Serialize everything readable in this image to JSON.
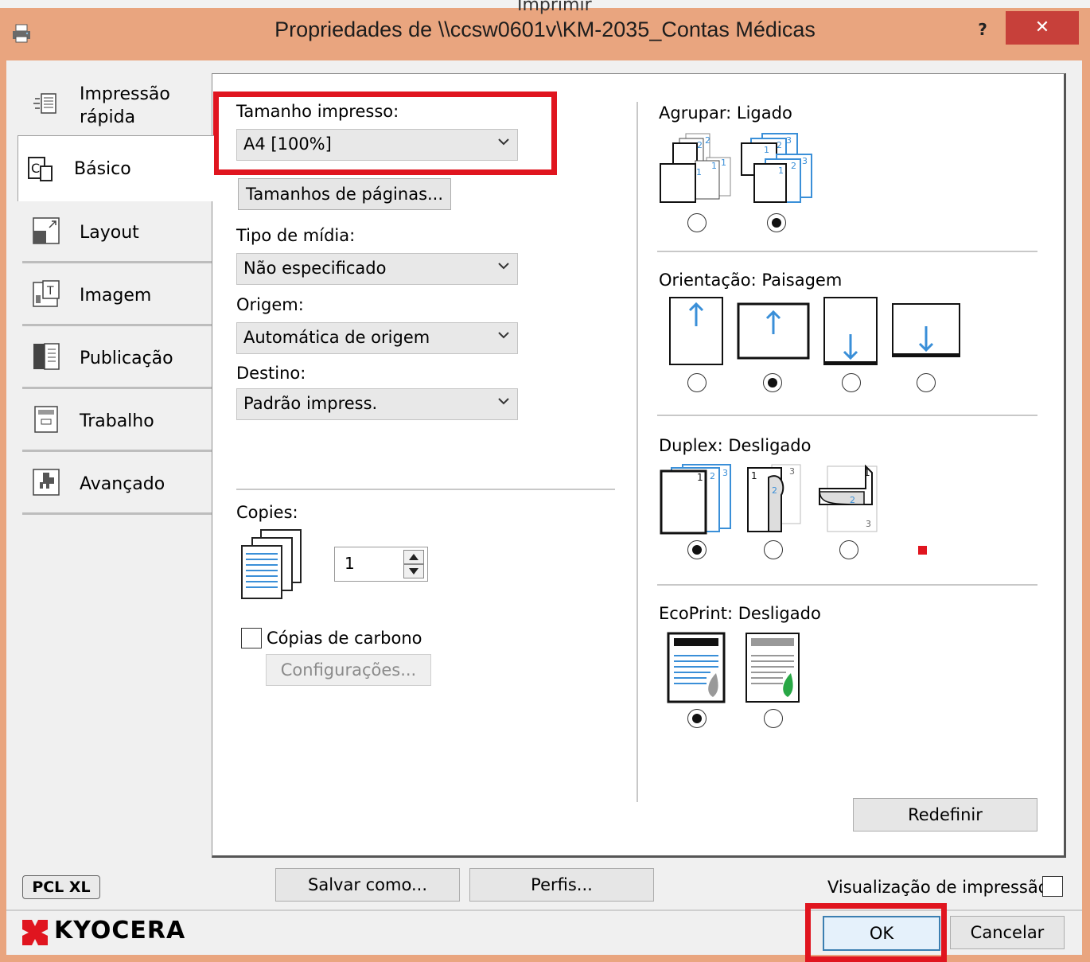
{
  "window": {
    "behind_title": "Imprimir",
    "title": "Propriedades de \\\\ccsw0601v\\KM-2035_Contas Médicas",
    "help": "?",
    "close": "✕",
    "frame_color": "#e9a57f",
    "close_color": "#c7403a"
  },
  "tabs": [
    {
      "label": "Impressão rápida",
      "line1": "Impressão",
      "line2": "rápida",
      "icon": "quick-print-icon"
    },
    {
      "label": "Básico",
      "icon": "basic-icon",
      "selected": true
    },
    {
      "label": "Layout",
      "icon": "layout-icon"
    },
    {
      "label": "Imagem",
      "icon": "image-icon"
    },
    {
      "label": "Publicação",
      "icon": "publishing-icon"
    },
    {
      "label": "Trabalho",
      "icon": "job-icon"
    },
    {
      "label": "Avançado",
      "icon": "advanced-icon"
    }
  ],
  "basic": {
    "print_size_label": "Tamanho impresso:",
    "print_size_value": "A4  [100%]",
    "page_sizes_button": "Tamanhos de páginas...",
    "media_type_label": "Tipo de mídia:",
    "media_type_value": "Não especificado",
    "source_label": "Origem:",
    "source_value": "Automática de origem",
    "destination_label": "Destino:",
    "destination_value": "Padrão impress.",
    "copies_label": "Copies:",
    "copies_value": "1",
    "carbon_copies_label": "Cópias de carbono",
    "carbon_copies_checked": false,
    "settings_button": "Configurações..."
  },
  "right": {
    "collate_label": "Agrupar:",
    "collate_value": "Ligado",
    "orientation_label": "Orientação:",
    "orientation_value": "Paisagem",
    "duplex_label": "Duplex:",
    "duplex_value": "Desligado",
    "ecoprint_label": "EcoPrint:",
    "ecoprint_value": "Desligado",
    "reset_button": "Redefinir"
  },
  "footer": {
    "pcl_badge": "PCL XL",
    "save_as_button": "Salvar como...",
    "profiles_button": "Perfis...",
    "print_preview_label": "Visualização de impressão",
    "brand": "KYOCERA",
    "ok_button": "OK",
    "cancel_button": "Cancelar"
  },
  "colors": {
    "highlight": "#e0151f",
    "accent_blue": "#3a8fd8"
  }
}
